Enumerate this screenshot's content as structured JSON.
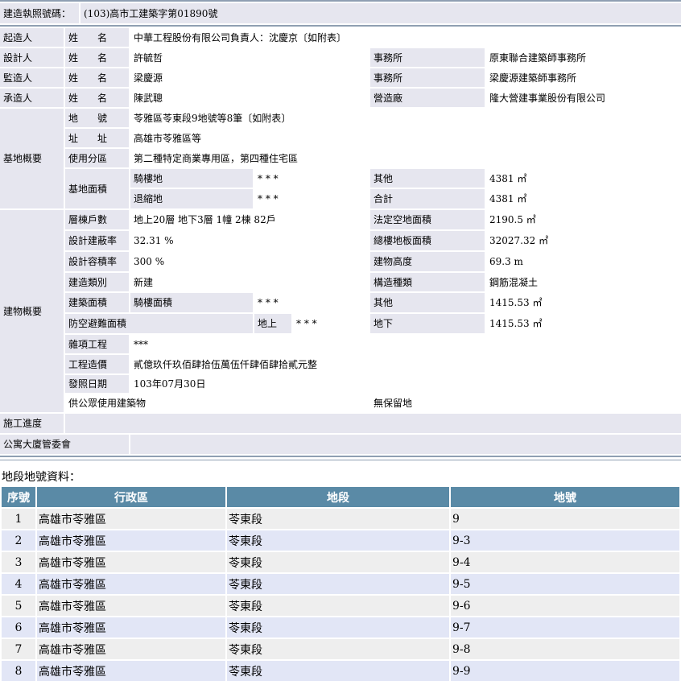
{
  "permit": {
    "label": "建造執照號碼：",
    "value": "(103)高市工建築字第01890號"
  },
  "starter": {
    "label": "起造人",
    "name_label": "姓　　名",
    "name": "中華工程股份有限公司負責人：沈慶京〔如附表〕"
  },
  "designer": {
    "label": "設計人",
    "name_label": "姓　　名",
    "name": "許毓哲",
    "office_label": "事務所",
    "office": "原東聯合建築師事務所"
  },
  "supervisor": {
    "label": "監造人",
    "name_label": "姓　　名",
    "name": "梁慶源",
    "office_label": "事務所",
    "office": "梁慶源建築師事務所"
  },
  "contractor": {
    "label": "承造人",
    "name_label": "姓　　名",
    "name": "陳武聰",
    "company_label": "營造廠",
    "company": "隆大營建事業股份有限公司"
  },
  "site": {
    "label": "基地概要",
    "lot_label": "地　　號",
    "lot": "苓雅區苓東段9地號等8筆〔如附表〕",
    "addr_label": "址　　址",
    "addr": "高雄市苓雅區等",
    "zone_label": "使用分區",
    "zone": "第二種特定商業專用區，第四種住宅區",
    "area_label": "基地面積",
    "arcade_label": "騎樓地",
    "arcade": "* * *",
    "other_label": "其他",
    "other": "4381 ㎡",
    "setback_label": "退縮地",
    "setback": "* * *",
    "total_label": "合計",
    "total": "4381 ㎡"
  },
  "building": {
    "label": "建物概要",
    "floors_label": "層棟戶數",
    "floors": "地上20層 地下3層 1幢 2棟 82戶",
    "open_label": "法定空地面積",
    "open": "2190.5 ㎡",
    "coverage_label": "設計建蔽率",
    "coverage": "32.31 %",
    "floorarea_label": "總樓地板面積",
    "floorarea": "32027.32 ㎡",
    "far_label": "設計容積率",
    "far": "300 %",
    "height_label": "建物高度",
    "height": "69.3 m",
    "category_label": "建造類別",
    "category": "新建",
    "structure_label": "構造種類",
    "structure": "鋼筋混凝土",
    "bldgarea_label": "建築面積",
    "arcadearea_label": "騎樓面積",
    "arcadearea": "* * *",
    "bldgother_label": "其他",
    "bldgother": "1415.53 ㎡",
    "shelter_label": "防空避難面積",
    "above_label": "地上",
    "above": "* * *",
    "below_label": "地下",
    "below": "1415.53 ㎡",
    "misc_label": "雜項工程",
    "misc": "***",
    "cost_label": "工程造價",
    "cost": "貳億玖仟玖佰肆拾伍萬伍仟肆佰肆拾貳元整",
    "issue_label": "發照日期",
    "issue": "103年07月30日",
    "public_label": "供公眾使用建築物",
    "public": "無保留地"
  },
  "progress": {
    "label": "施工進度"
  },
  "committee": {
    "label": "公寓大廈管委會"
  },
  "lots": {
    "caption": "地段地號資料：",
    "headers": [
      "序號",
      "行政區",
      "地段",
      "地號"
    ],
    "rows": [
      [
        "1",
        "高雄市苓雅區",
        "苓東段",
        "9"
      ],
      [
        "2",
        "高雄市苓雅區",
        "苓東段",
        "9-3"
      ],
      [
        "3",
        "高雄市苓雅區",
        "苓東段",
        "9-4"
      ],
      [
        "4",
        "高雄市苓雅區",
        "苓東段",
        "9-5"
      ],
      [
        "5",
        "高雄市苓雅區",
        "苓東段",
        "9-6"
      ],
      [
        "6",
        "高雄市苓雅區",
        "苓東段",
        "9-7"
      ],
      [
        "7",
        "高雄市苓雅區",
        "苓東段",
        "9-8"
      ],
      [
        "8",
        "高雄市苓雅區",
        "苓東段",
        "9-9"
      ]
    ],
    "colors": {
      "header": "#5a8aa6",
      "odd": "#eeeeee",
      "even": "#e2e6f6"
    }
  }
}
